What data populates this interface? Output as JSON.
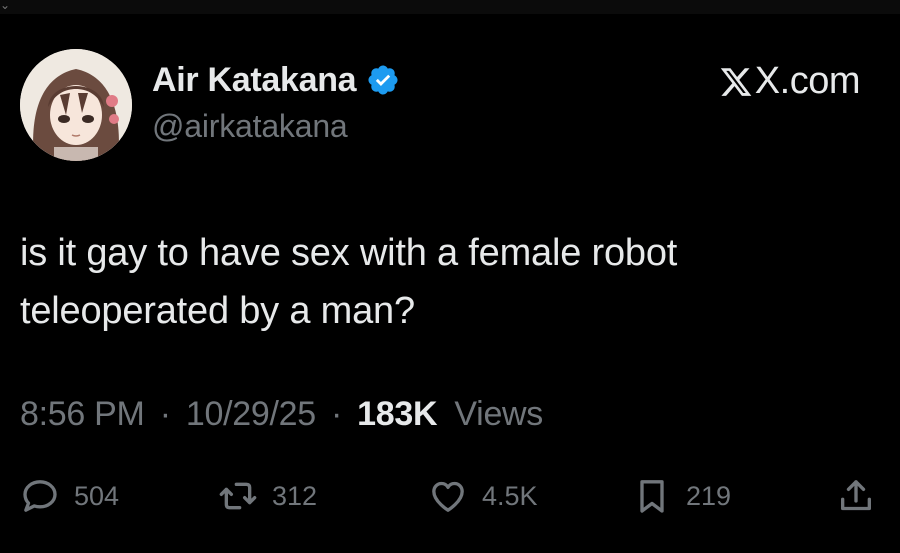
{
  "author": {
    "display_name": "Air Katakana",
    "handle": "@airkatakana",
    "verified": true,
    "avatar": "anime-girl-avatar"
  },
  "brand": {
    "label": "X.com",
    "icon": "x-logo-icon"
  },
  "tweet": {
    "text_line1": "is it gay to have sex with a female robot",
    "text_line2": "teleoperated by a man?"
  },
  "meta": {
    "time": "8:56 PM",
    "date": "10/29/25",
    "views_count": "183K",
    "views_label": "Views",
    "separator": "·"
  },
  "actions": {
    "replies": "504",
    "reposts": "312",
    "likes": "4.5K",
    "bookmarks": "219"
  },
  "colors": {
    "background": "#000000",
    "text": "#e7e9ea",
    "secondary": "#71767b",
    "verified": "#1d9bf0"
  }
}
